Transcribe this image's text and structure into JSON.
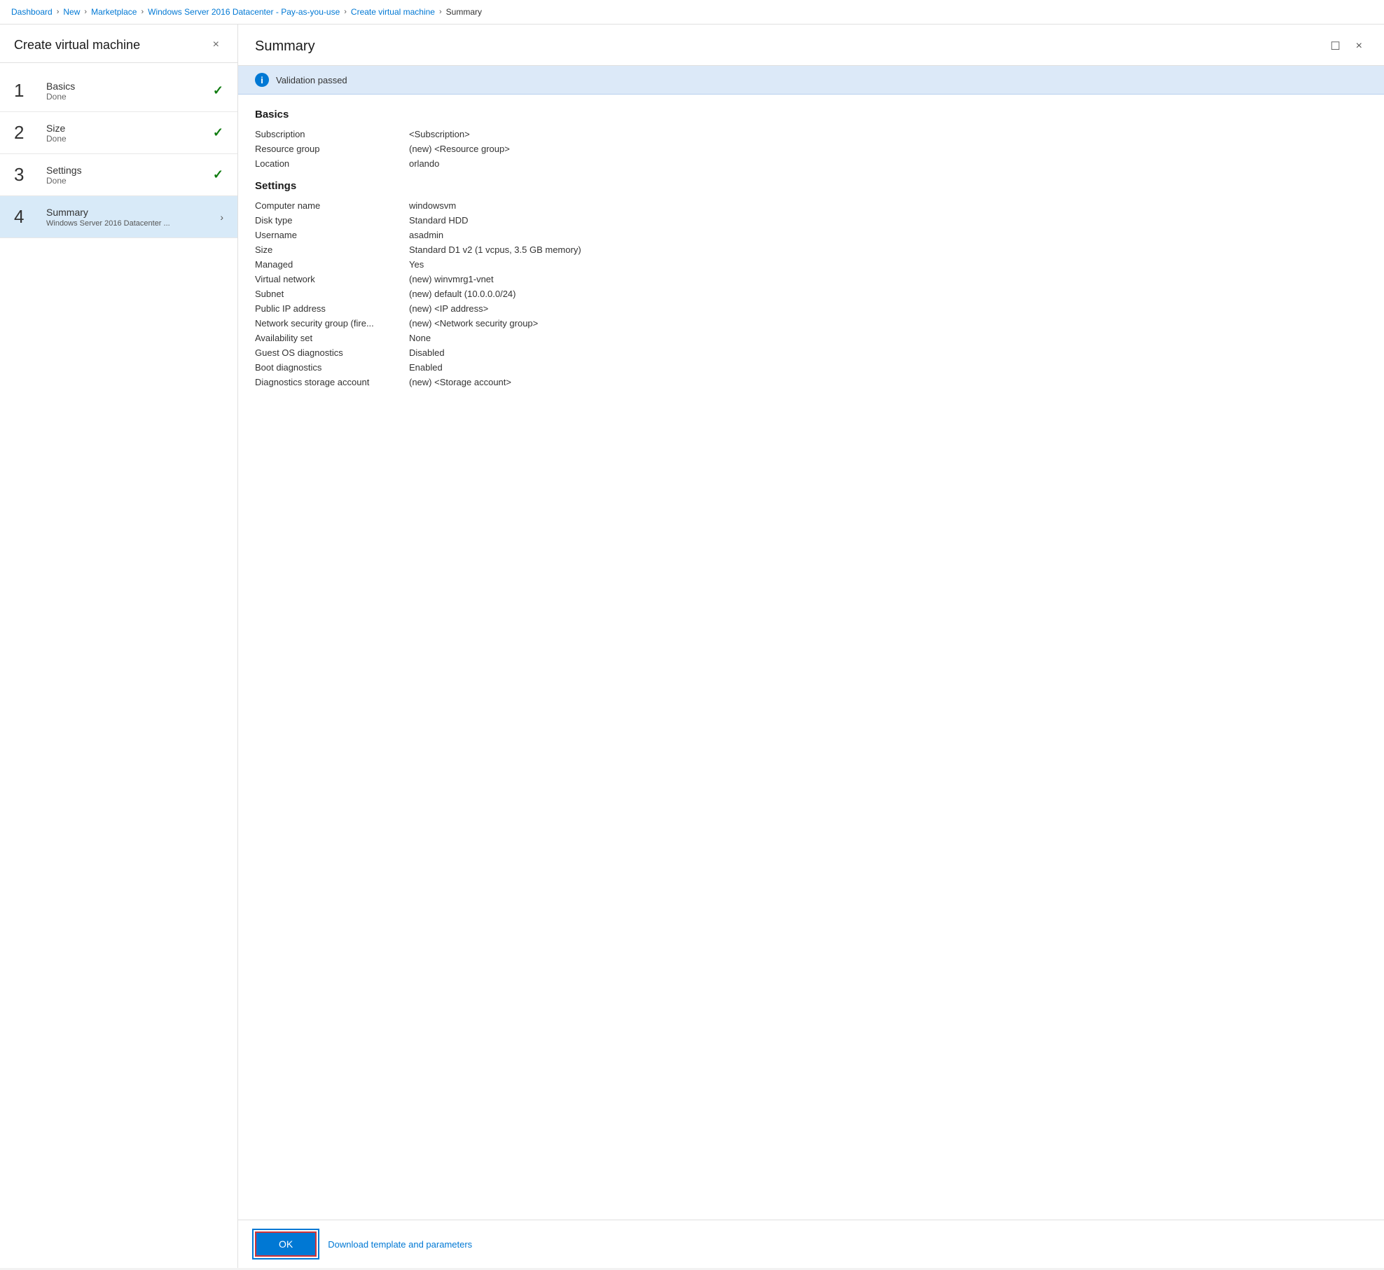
{
  "breadcrumb": {
    "items": [
      {
        "label": "Dashboard",
        "active": false
      },
      {
        "label": "New",
        "active": false
      },
      {
        "label": "Marketplace",
        "active": false
      },
      {
        "label": "Windows Server 2016 Datacenter - Pay-as-you-use",
        "active": false
      },
      {
        "label": "Create virtual machine",
        "active": false
      },
      {
        "label": "Summary",
        "active": true
      }
    ],
    "separator": ">"
  },
  "left_panel": {
    "title": "Create virtual machine",
    "close_btn": "×",
    "steps": [
      {
        "number": "1",
        "name": "Basics",
        "status": "Done",
        "check": "✓",
        "active": false,
        "subtitle": ""
      },
      {
        "number": "2",
        "name": "Size",
        "status": "Done",
        "check": "✓",
        "active": false,
        "subtitle": ""
      },
      {
        "number": "3",
        "name": "Settings",
        "status": "Done",
        "check": "✓",
        "active": false,
        "subtitle": ""
      },
      {
        "number": "4",
        "name": "Summary",
        "status": "",
        "check": "",
        "active": true,
        "subtitle": "Windows Server 2016 Datacenter ..."
      }
    ]
  },
  "right_panel": {
    "title": "Summary",
    "maximize_btn": "☐",
    "close_btn": "×",
    "validation": {
      "icon": "i",
      "text": "Validation passed"
    },
    "sections": [
      {
        "title": "Basics",
        "rows": [
          {
            "label": "Subscription",
            "value": "<Subscription>"
          },
          {
            "label": "Resource group",
            "value": "(new) <Resource group>"
          },
          {
            "label": "Location",
            "value": "orlando"
          }
        ]
      },
      {
        "title": "Settings",
        "rows": [
          {
            "label": "Computer name",
            "value": "windowsvm"
          },
          {
            "label": "Disk type",
            "value": "Standard HDD"
          },
          {
            "label": "Username",
            "value": "asadmin"
          },
          {
            "label": "Size",
            "value": "Standard D1 v2 (1 vcpus, 3.5 GB memory)"
          },
          {
            "label": "Managed",
            "value": "Yes"
          },
          {
            "label": "Virtual network",
            "value": "(new) winvmrg1-vnet"
          },
          {
            "label": "Subnet",
            "value": "(new) default (10.0.0.0/24)"
          },
          {
            "label": "Public IP address",
            "value": "(new) <IP address>"
          },
          {
            "label": "Network security group (fire...",
            "value": "(new) <Network security group>"
          },
          {
            "label": "Availability set",
            "value": "None"
          },
          {
            "label": "Guest OS diagnostics",
            "value": "Disabled"
          },
          {
            "label": "Boot diagnostics",
            "value": "Enabled"
          },
          {
            "label": "Diagnostics storage account",
            "value": " (new) <Storage account>"
          }
        ]
      }
    ],
    "footer": {
      "ok_btn": "OK",
      "download_link": "Download template and parameters"
    }
  }
}
